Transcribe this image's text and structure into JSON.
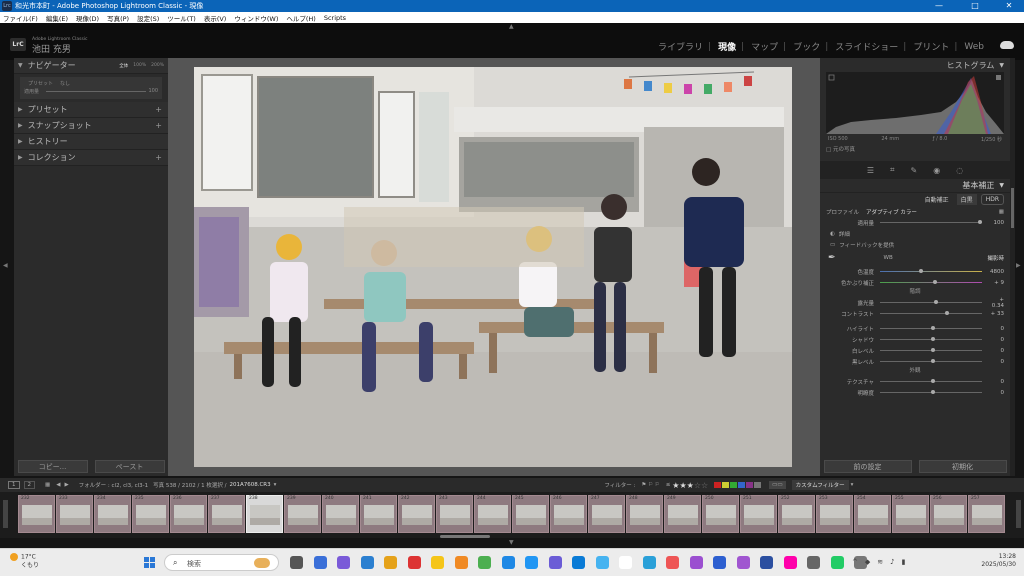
{
  "window": {
    "app_icon": "Lrc",
    "title": "和光市本町 - Adobe Photoshop Lightroom Classic - 現像",
    "controls": {
      "minimize": "—",
      "maximize": "□",
      "close": "✕"
    }
  },
  "menu": [
    "ファイル(F)",
    "編集(E)",
    "現像(D)",
    "写真(P)",
    "設定(S)",
    "ツール(T)",
    "表示(V)",
    "ウィンドウ(W)",
    "ヘルプ(H)",
    "Scripts"
  ],
  "identity": {
    "logo": "LrC",
    "app_name": "Adobe Lightroom Classic",
    "user": "池田 充男"
  },
  "modules": [
    "ライブラリ",
    "現像",
    "マップ",
    "ブック",
    "スライドショー",
    "プリント",
    "Web"
  ],
  "active_module": "現像",
  "left_panel": {
    "navigator": {
      "label": "ナビゲーター",
      "options": [
        "全体",
        "100%",
        "200%"
      ],
      "preset_label": "プリセット",
      "preset_value": "なし",
      "amount_label": "適用量",
      "amount_value": "100"
    },
    "sections": [
      {
        "label": "プリセット",
        "plus": "+"
      },
      {
        "label": "スナップショット",
        "plus": "+"
      },
      {
        "label": "ヒストリー",
        "plus": ""
      },
      {
        "label": "コレクション",
        "plus": "+"
      }
    ],
    "copy_button": "コピー...",
    "paste_button": "ペースト"
  },
  "right_panel": {
    "histogram_label": "ヒストグラム",
    "histogram_info": {
      "iso": "ISO 500",
      "focal": "24 mm",
      "aperture": "ƒ / 8.0",
      "shutter": "1/250 秒"
    },
    "original_photo": "元の写真",
    "basic_label": "基本補正",
    "auto_button": "自動補正",
    "bw_button": "白黒",
    "hdr_button": "HDR",
    "profile_label": "プロファイル",
    "profile_value": "アダプティブ カラー",
    "profile_amount_label": "適用量",
    "profile_amount_value": "100",
    "detail_label": "詳細",
    "feedback_label": "フィードバックを提供",
    "wb_label": "WB",
    "wb_value": "撮影時",
    "sliders_wb": [
      {
        "label": "色温度",
        "value": "4800",
        "pos": 0.38
      },
      {
        "label": "色かぶり補正",
        "value": "+ 9",
        "pos": 0.52
      }
    ],
    "tone_label": "階調",
    "sliders_tone": [
      {
        "label": "露光量",
        "value": "+ 0.34",
        "pos": 0.53
      },
      {
        "label": "コントラスト",
        "value": "+ 33",
        "pos": 0.64
      }
    ],
    "sliders_tone2": [
      {
        "label": "ハイライト",
        "value": "0",
        "pos": 0.5
      },
      {
        "label": "シャドウ",
        "value": "0",
        "pos": 0.5
      },
      {
        "label": "白レベル",
        "value": "0",
        "pos": 0.5
      },
      {
        "label": "黒レベル",
        "value": "0",
        "pos": 0.5
      }
    ],
    "presence_label": "外観",
    "sliders_presence": [
      {
        "label": "テクスチャ",
        "value": "0",
        "pos": 0.5
      },
      {
        "label": "明瞭度",
        "value": "0",
        "pos": 0.5
      }
    ],
    "prev_button": "前の設定",
    "reset_button": "初期化"
  },
  "filmstrip_bar": {
    "page1": "1",
    "page2": "2",
    "folder": "フォルダー : cl2, cl3, cl3-1",
    "count": "写真 538 / 2102 / 1 枚選択 /",
    "filename": "201A7608.CR3",
    "filter_label": "フィルター :",
    "rating_op": "≤",
    "stars": "★★★",
    "empty_stars": "☆☆",
    "color_labels": [
      "#c22",
      "#cc3",
      "#3a3",
      "#36c",
      "#838",
      "#777"
    ],
    "custom_filter": "カスタムフィルター"
  },
  "thumbs": [
    "232",
    "233",
    "234",
    "235",
    "236",
    "237",
    "238",
    "239",
    "240",
    "241",
    "242",
    "243",
    "244",
    "245",
    "246",
    "247",
    "248",
    "249",
    "250",
    "251",
    "252",
    "253",
    "254",
    "255",
    "256",
    "257"
  ],
  "selected_thumb": "238",
  "taskbar": {
    "weather_temp": "17°C",
    "weather_desc": "くもり",
    "search_placeholder": "検索",
    "time": "13:28",
    "date": "2025/05/30"
  }
}
